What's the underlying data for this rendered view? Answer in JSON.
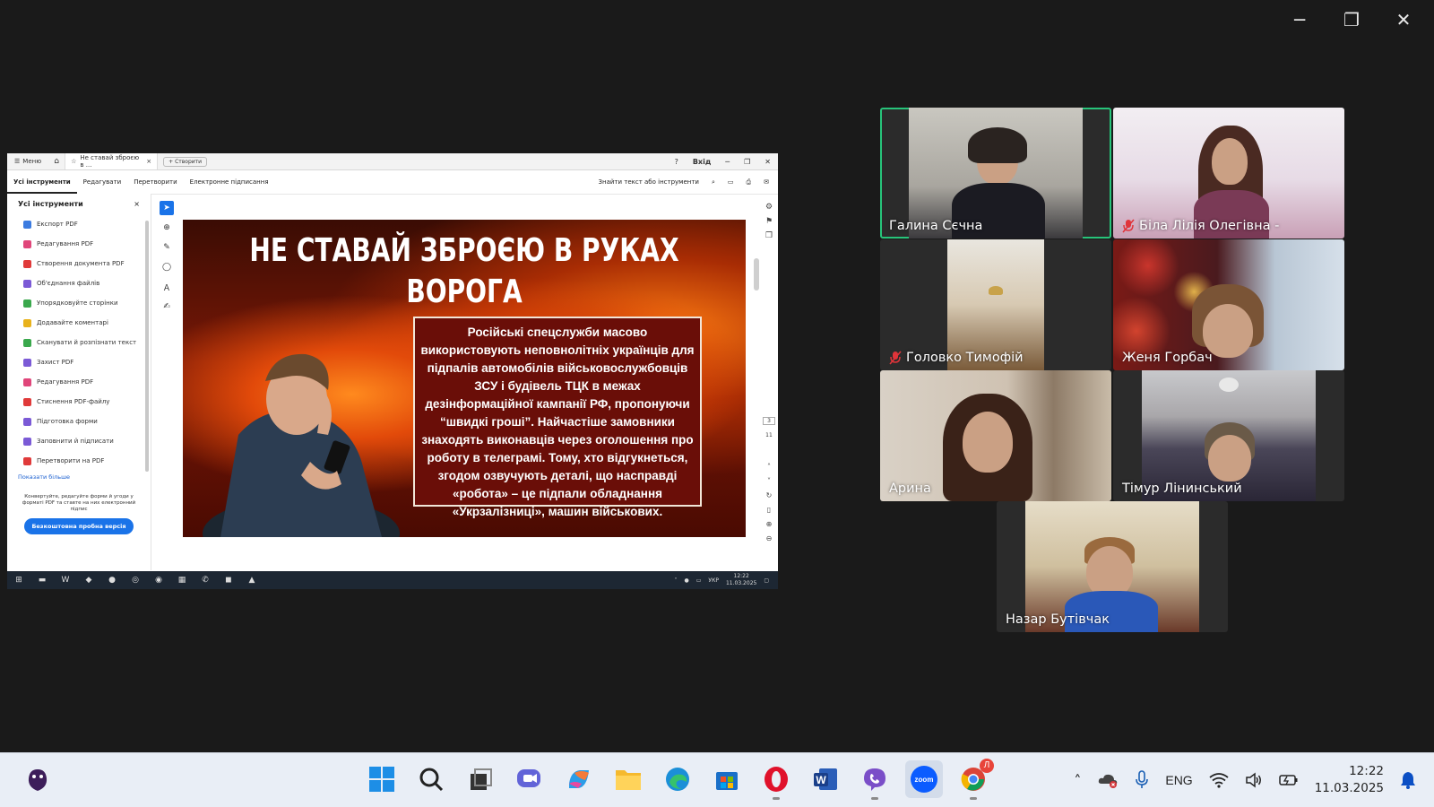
{
  "window_controls": {
    "minimize": "─",
    "restore": "❐",
    "close": "✕"
  },
  "share": {
    "tabbar": {
      "menu": "Меню",
      "tab_title": "Не ставай зброєю в ...",
      "create": "Створити",
      "help": "?",
      "login": "Вхід"
    },
    "toolbar": {
      "tabs": [
        "Усі інструменти",
        "Редагувати",
        "Перетворити",
        "Електронне підписання"
      ],
      "search": "Знайти текст або інструменти"
    },
    "panel": {
      "title": "Усі інструменти",
      "tools": [
        {
          "label": "Експорт PDF",
          "color": "#3b7be0"
        },
        {
          "label": "Редагування PDF",
          "color": "#e0467a"
        },
        {
          "label": "Створення документа PDF",
          "color": "#e03a3a"
        },
        {
          "label": "Об'єднання файлів",
          "color": "#7b5ad6"
        },
        {
          "label": "Упорядковуйте сторінки",
          "color": "#3aa84c"
        },
        {
          "label": "Додавайте коментарі",
          "color": "#e8b21c"
        },
        {
          "label": "Сканувати й розпізнати текст",
          "color": "#3aa84c"
        },
        {
          "label": "Захист PDF",
          "color": "#7b5ad6"
        },
        {
          "label": "Редагування PDF",
          "color": "#e0467a"
        },
        {
          "label": "Стиснення PDF-файлу",
          "color": "#e03a3a"
        },
        {
          "label": "Підготовка форми",
          "color": "#7b5ad6"
        },
        {
          "label": "Заповнити й підписати",
          "color": "#7b5ad6"
        },
        {
          "label": "Перетворити на PDF",
          "color": "#e03a3a"
        }
      ],
      "show_more": "Показати більше",
      "promo": "Конвертуйте, редагуйте форми й угоди у форматі PDF та ставте на них електронний підпис",
      "trial": "Безкоштовна пробна версія"
    },
    "slide": {
      "title": "НЕ СТАВАЙ ЗБРОЄЮ В РУКАХ ВОРОГА",
      "body": "Російські спецслужби масово використовують неповнолітніх українців для підпалів автомобілів військовослужбовців ЗСУ і будівель ТЦК в межах дезінформаційної кампанії РФ, пропонуючи “швидкі гроші”. Найчастіше замовники знаходять виконавців через оголошення про роботу в телеграмі. Тому, хто відгукнеться, згодом озвучують деталі, що насправді «робота» – це підпали обладнання «Укрзалізниці», машин військових."
    },
    "page_current": "3",
    "page_total": "11",
    "win10": {
      "lang": "УКР",
      "time": "12:22",
      "date": "11.03.2025"
    }
  },
  "participants": [
    {
      "name": "Галина Сєчна",
      "muted": false,
      "active": true
    },
    {
      "name": "Біла Лілія Олегівна -",
      "muted": true,
      "active": false
    },
    {
      "name": "Головко Тимофій",
      "muted": true,
      "active": false
    },
    {
      "name": "Женя Горбач",
      "muted": false,
      "active": false
    },
    {
      "name": "Арина",
      "muted": false,
      "active": false
    },
    {
      "name": "Тімур Лінинський",
      "muted": false,
      "active": false
    },
    {
      "name": "Назар Бутівчак",
      "muted": false,
      "active": false
    }
  ],
  "taskbar": {
    "apps": [
      "start-icon",
      "search-icon",
      "task-view-icon",
      "teams-chat-icon",
      "copilot-icon",
      "file-explorer-icon",
      "edge-icon",
      "store-icon",
      "opera-icon",
      "word-icon",
      "viber-icon",
      "zoom-icon",
      "chrome-icon"
    ],
    "chrome_badge": "Л",
    "lang": "ENG",
    "time": "12:22",
    "date": "11.03.2025"
  }
}
